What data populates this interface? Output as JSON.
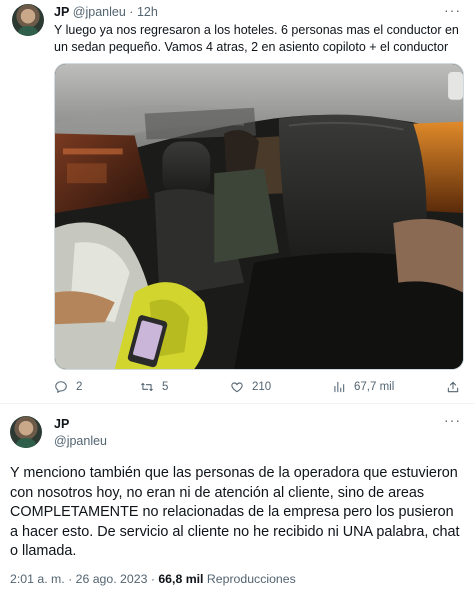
{
  "tweet1": {
    "author_name": "JP",
    "author_handle": "@jpanleu",
    "separator": "·",
    "time_ago": "12h",
    "text": "Y luego ya nos regresaron a los hoteles. 6 personas mas el conductor en un sedan pequeño. Vamos 4 atras, 2 en asiento copiloto + el conductor",
    "more_icon": "more-icon",
    "actions": {
      "replies": "2",
      "retweets": "5",
      "likes": "210",
      "views": "67,7 mil"
    }
  },
  "tweet2": {
    "author_name": "JP",
    "author_handle": "@jpanleu",
    "text": "Y menciono también que las personas de la operadora que estuvieron con nosotros hoy, no eran ni de atención al cliente, sino de areas COMPLETAMENTE no relacionadas de la empresa pero los pusieron a hacer esto. De servicio al cliente no he recibido ni UNA palabra, chat o llamada.",
    "timestamp": "2:01 a. m. · 26 ago. 2023 · ",
    "views_count": "66,8 mil",
    "views_label": " Reproducciones"
  }
}
